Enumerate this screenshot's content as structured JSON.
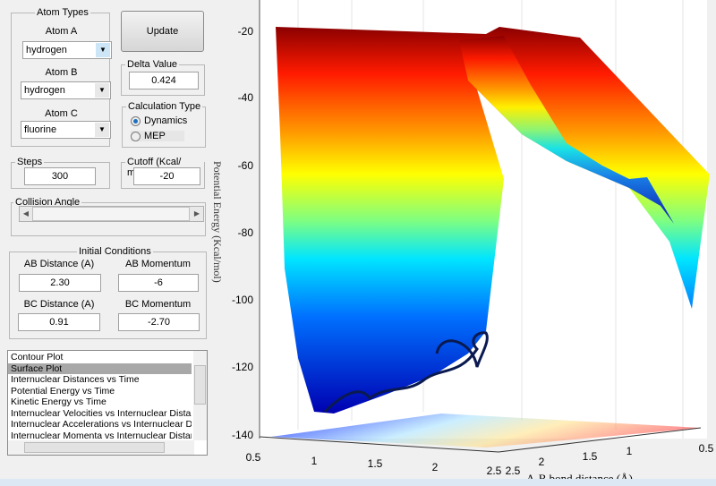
{
  "atom_types": {
    "title": "Atom Types",
    "atom_a_label": "Atom A",
    "atom_a": "hydrogen",
    "atom_b_label": "Atom B",
    "atom_b": "hydrogen",
    "atom_c_label": "Atom C",
    "atom_c": "fluorine"
  },
  "update_label": "Update",
  "delta": {
    "title": "Delta Value",
    "value": "0.424"
  },
  "calc_type": {
    "title": "Calculation Type",
    "options": [
      "Dynamics",
      "MEP"
    ],
    "selected": "Dynamics"
  },
  "steps": {
    "title": "Steps",
    "value": "300"
  },
  "cutoff": {
    "title": "Cutoff (Kcal/ mol)",
    "value": "-20"
  },
  "collision": {
    "title": "Collision Angle"
  },
  "initial": {
    "title": "Initial Conditions",
    "ab_dist_label": "AB Distance (A)",
    "ab_dist": "2.30",
    "ab_mom_label": "AB Momentum",
    "ab_mom": "-6",
    "bc_dist_label": "BC Distance (A)",
    "bc_dist": "0.91",
    "bc_mom_label": "BC Momentum",
    "bc_mom": "-2.70"
  },
  "plot_list": {
    "items": [
      "Contour Plot",
      "Surface Plot",
      "Internuclear Distances vs Time",
      "Potential Energy vs Time",
      "Kinetic Energy vs Time",
      "Internuclear Velocities vs Internuclear Distance",
      "Internuclear Accelerations vs Internuclear Dista",
      "Internuclear Momenta vs Internuclear Distance"
    ],
    "selected": "Surface Plot"
  },
  "plot": {
    "zlabel": "Potential Energy (Kcal/mol)",
    "xlabel": "A-B bond distance (Å)",
    "zticks": [
      "-20",
      "-40",
      "-60",
      "-80",
      "-100",
      "-120",
      "-140"
    ],
    "xticks_left": [
      "0.5",
      "1",
      "1.5",
      "2",
      "2.5"
    ],
    "xticks_right": [
      "2.5",
      "2",
      "1.5",
      "1",
      "0.5"
    ]
  }
}
